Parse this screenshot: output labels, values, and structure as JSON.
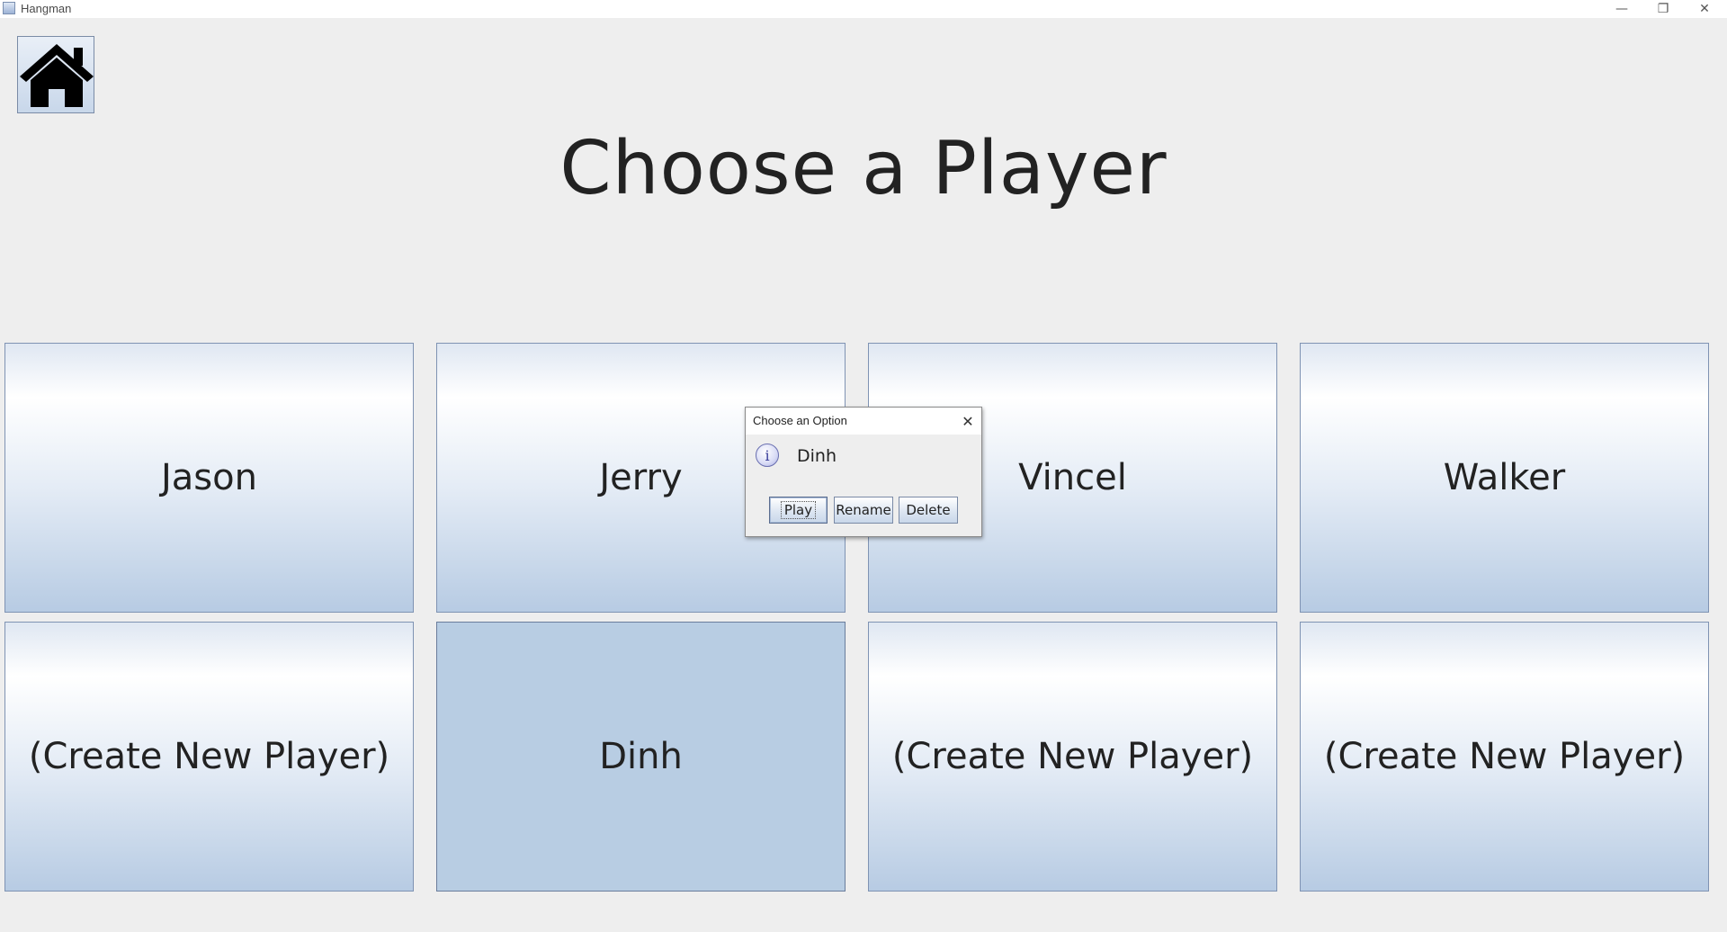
{
  "window": {
    "title": "Hangman",
    "minimize_glyph": "—",
    "maximize_glyph": "❐",
    "close_glyph": "✕"
  },
  "home_button": {
    "icon": "home-icon"
  },
  "page": {
    "title": "Choose a Player"
  },
  "players": {
    "row0": [
      "Jason",
      "Jerry",
      "Vincel",
      "Walker"
    ],
    "row1": [
      "(Create New Player)",
      "Dinh",
      "(Create New Player)",
      "(Create New Player)"
    ],
    "selected": "Dinh"
  },
  "dialog": {
    "title": "Choose an Option",
    "close_glyph": "✕",
    "icon": "info-icon",
    "icon_glyph": "i",
    "message": "Dinh",
    "buttons": {
      "play": "Play",
      "rename": "Rename",
      "delete": "Delete"
    }
  },
  "colors": {
    "background": "#eeeeee",
    "tile_selected": "#b8cde3",
    "tile_border": "#7f93b3"
  }
}
